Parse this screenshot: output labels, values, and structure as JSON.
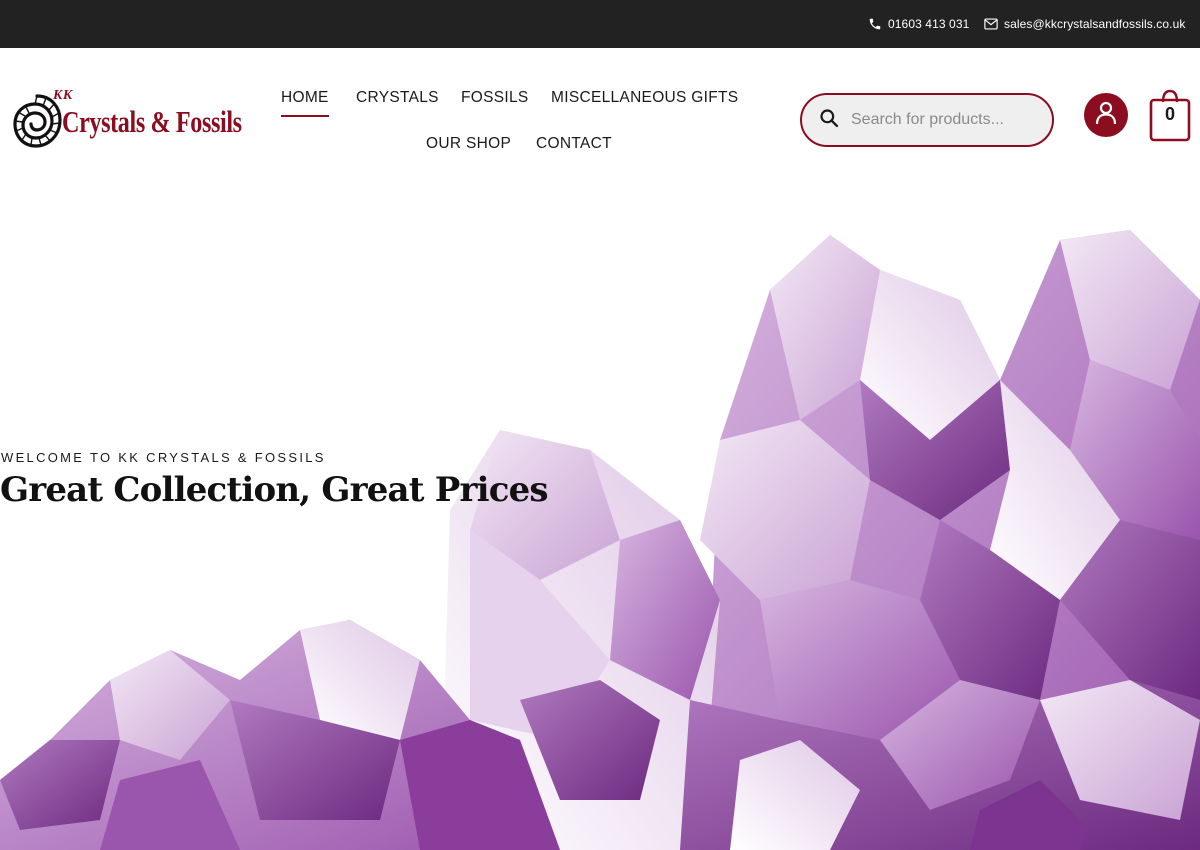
{
  "topbar": {
    "phone": "01603 413 031",
    "email": "sales@kkcrystalsandfossils.co.uk",
    "phone_icon": "phone-icon",
    "email_icon": "envelope-icon"
  },
  "logo": {
    "kk": "KK",
    "name": "Crystals & Fossils",
    "icon": "ammonite-icon"
  },
  "nav": {
    "items": [
      {
        "label": "HOME",
        "active": true
      },
      {
        "label": "CRYSTALS"
      },
      {
        "label": "FOSSILS"
      },
      {
        "label": "MISCELLANEOUS GIFTS"
      },
      {
        "label": "OUR SHOP"
      },
      {
        "label": "CONTACT"
      }
    ]
  },
  "search": {
    "placeholder": "Search for products...",
    "icon": "search-icon"
  },
  "account": {
    "icon": "user-icon"
  },
  "cart": {
    "count": "0",
    "icon": "shopping-bag-icon"
  },
  "hero": {
    "eyebrow": "WELCOME TO KK CRYSTALS & FOSSILS",
    "headline": "Great Collection, Great Prices",
    "image": "amethyst-crystals"
  },
  "colors": {
    "brand": "#8b0d1f",
    "topbar_bg": "#222222",
    "amethyst_dark": "#8a3d9a",
    "amethyst_mid": "#b67fc6",
    "amethyst_light": "#e8d3ec"
  }
}
